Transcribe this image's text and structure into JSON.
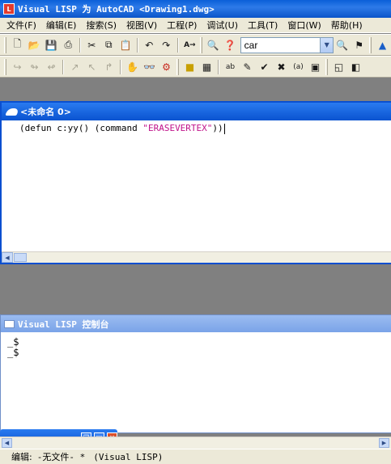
{
  "titlebar": {
    "title": "Visual LISP 为 AutoCAD <Drawing1.dwg>"
  },
  "menubar": {
    "items": [
      "文件(F)",
      "编辑(E)",
      "搜索(S)",
      "视图(V)",
      "工程(P)",
      "调试(U)",
      "工具(T)",
      "窗口(W)",
      "帮助(H)"
    ]
  },
  "toolbar": {
    "search_value": "car"
  },
  "editor": {
    "title": "<未命名 0>",
    "code_start": "(defun c:yy() (command ",
    "code_string": "\"ERASEVERTEX\"",
    "code_end": "))"
  },
  "console": {
    "title": "Visual LISP 控制台",
    "prompt_1": "_$",
    "prompt_2": "_$"
  },
  "statusbar": {
    "mode": "编辑:",
    "file": "-无文件- *",
    "context": "(Visual LISP)"
  }
}
